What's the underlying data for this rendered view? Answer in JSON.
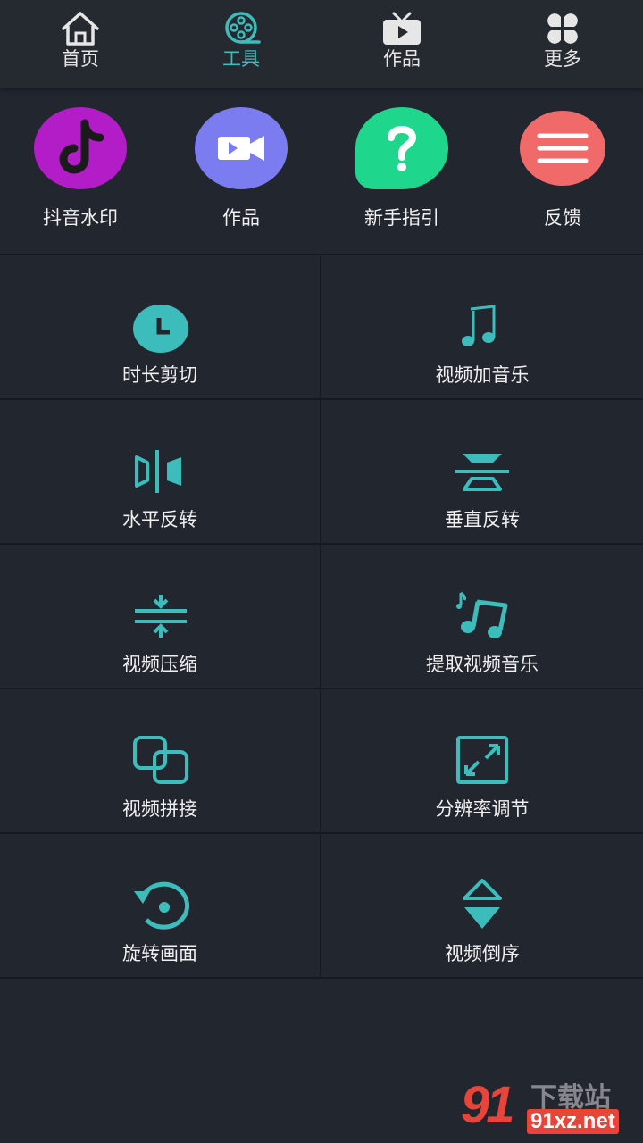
{
  "tabs": [
    {
      "label": "首页",
      "icon": "home-icon",
      "active": false
    },
    {
      "label": "工具",
      "icon": "film-reel-icon",
      "active": true
    },
    {
      "label": "作品",
      "icon": "tv-icon",
      "active": false
    },
    {
      "label": "更多",
      "icon": "four-petal-icon",
      "active": false
    }
  ],
  "quick_actions": [
    {
      "label": "抖音水印",
      "icon": "tiktok-icon",
      "color": "#b21dc8"
    },
    {
      "label": "作品",
      "icon": "video-camera-icon",
      "color": "#7b7cf0"
    },
    {
      "label": "新手指引",
      "icon": "question-bubble-icon",
      "color": "#1ed68c"
    },
    {
      "label": "反馈",
      "icon": "menu-bubble-icon",
      "color": "#f16a6a"
    }
  ],
  "tools": [
    {
      "label": "时长剪切",
      "icon": "clock-icon"
    },
    {
      "label": "视频加音乐",
      "icon": "music-note-icon"
    },
    {
      "label": "水平反转",
      "icon": "flip-horizontal-icon"
    },
    {
      "label": "垂直反转",
      "icon": "flip-vertical-icon"
    },
    {
      "label": "视频压缩",
      "icon": "compress-icon"
    },
    {
      "label": "提取视频音乐",
      "icon": "extract-music-icon"
    },
    {
      "label": "视频拼接",
      "icon": "merge-icon"
    },
    {
      "label": "分辨率调节",
      "icon": "resize-icon"
    },
    {
      "label": "旋转画面",
      "icon": "rotate-icon"
    },
    {
      "label": "视频倒序",
      "icon": "reverse-icon"
    }
  ],
  "watermark": {
    "logo": "91",
    "site_cn": "下载站",
    "url": "91xz.net"
  },
  "colors": {
    "accent": "#3dbcbc",
    "background": "#22262f",
    "divider": "#151920"
  }
}
